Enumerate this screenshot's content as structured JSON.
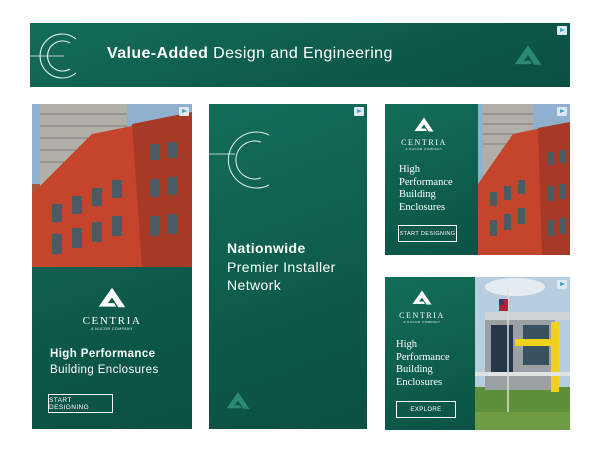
{
  "banner": {
    "headline_bold": "Value-Added",
    "headline_rest": "Design and Engineering"
  },
  "tower": {
    "brand": "CENTRIA",
    "sub_brand": "A NUCOR COMPANY",
    "line1": "High Performance",
    "line2": "Building Enclosures",
    "button": "START DESIGNING"
  },
  "middle": {
    "line1": "Nationwide",
    "line2": "Premier Installer",
    "line3": "Network"
  },
  "square_top": {
    "brand": "CENTRIA",
    "sub_brand": "A NUCOR COMPANY",
    "lines": [
      "High",
      "Performance",
      "Building",
      "Enclosures"
    ],
    "button": "START DESIGNING"
  },
  "square_bottom": {
    "brand": "CENTRIA",
    "sub_brand": "A NUCOR COMPANY",
    "lines": [
      "High",
      "Performance",
      "Building",
      "Enclosures"
    ],
    "button": "EXPLORE"
  },
  "colors": {
    "brand_green": "#0f6150",
    "facade_red": "#c4442c"
  },
  "icons": [
    "c-mark-icon",
    "triangle-logo-icon",
    "ad-choices-icon"
  ]
}
